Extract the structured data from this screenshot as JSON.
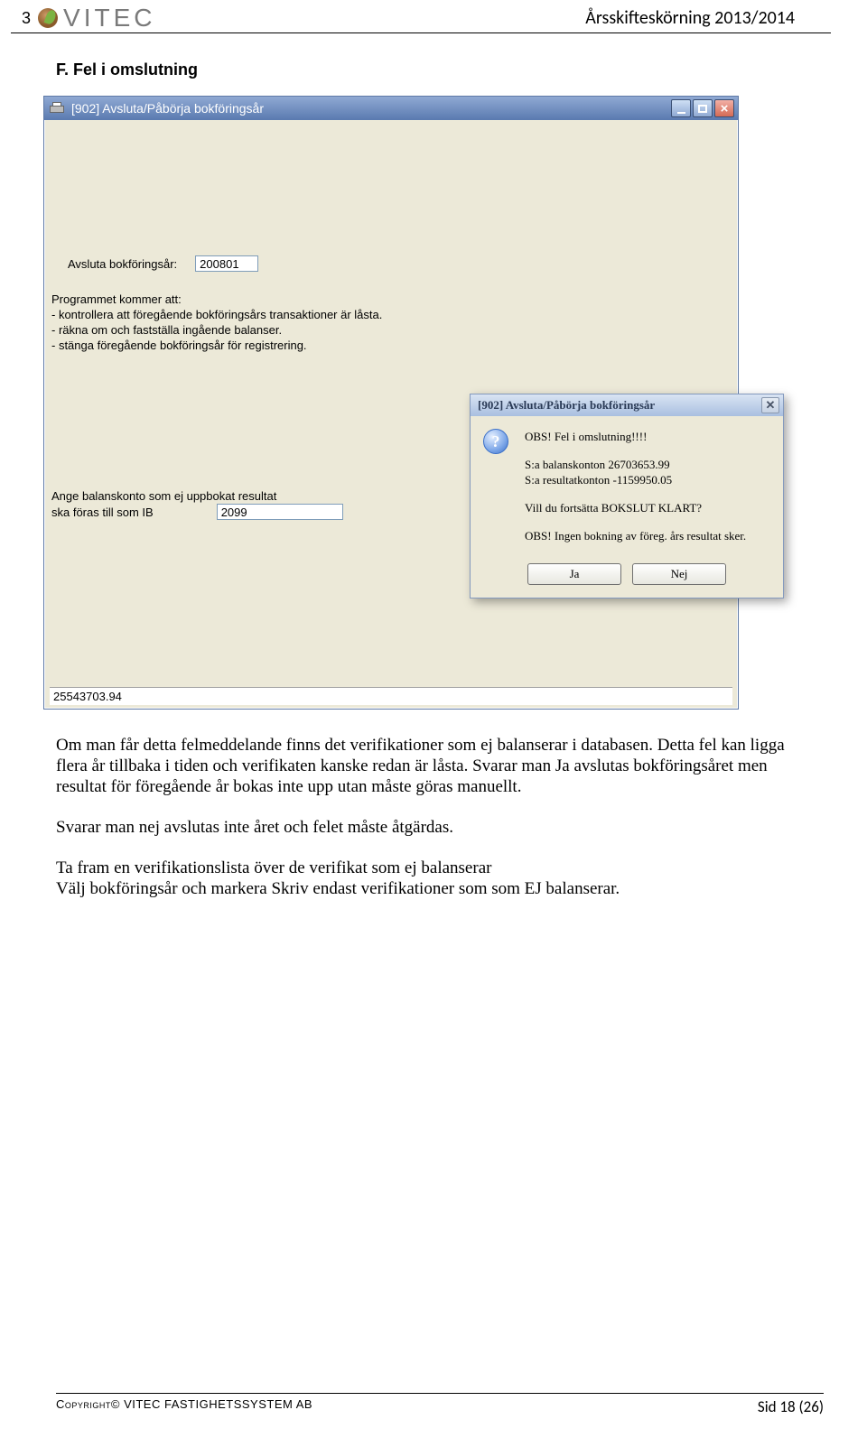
{
  "header": {
    "page_prefix": "3",
    "brand": "VITEC",
    "doc_title": "Årsskifteskörning 2013/2014"
  },
  "section_title": "F. Fel i omslutning",
  "main_window": {
    "title": "[902]  Avsluta/Påbörja bokföringsår",
    "avsluta_label": "Avsluta bokföringsår:",
    "avsluta_value": "200801",
    "info_heading": "Programmet kommer att:",
    "info_line1": "- kontrollera att föregående bokföringsårs transaktioner är låsta.",
    "info_line2": "- räkna om och fastställa ingående balanser.",
    "info_line3": "- stänga föregående bokföringsår för registrering.",
    "bal_line1": "Ange balanskonto som ej uppbokat resultat",
    "bal_line2": "ska föras till som IB",
    "bal_value": "2099",
    "status_number": "25543703.94"
  },
  "dialog": {
    "title": "[902]  Avsluta/Påbörja bokföringsår",
    "line1": "OBS! Fel i omslutning!!!!",
    "line2": "S:a balanskonton 26703653.99",
    "line3": "S:a resultatkonton -1159950.05",
    "line4": "Vill du fortsätta BOKSLUT KLART?",
    "line5": "OBS! Ingen bokning av föreg. års resultat sker.",
    "btn_yes": "Ja",
    "btn_no": "Nej"
  },
  "body": {
    "p1": "Om man får detta felmeddelande finns det verifikationer som ej balanserar i databasen. Detta fel kan ligga flera år tillbaka i tiden och verifikaten kanske redan är låsta. Svarar man Ja avslutas bokföringsåret men resultat för föregående år bokas inte upp utan måste göras manuellt.",
    "p2": "Svarar man nej avslutas inte året och felet måste åtgärdas.",
    "p3": "Ta fram en verifikationslista över de verifikat som ej balanserar\nVälj bokföringsår och markera Skriv endast verifikationer som som EJ balanserar."
  },
  "footer": {
    "copyright": "Copyright© VITEC FASTIGHETSSYSTEM AB",
    "page": "Sid 18 (26)"
  }
}
